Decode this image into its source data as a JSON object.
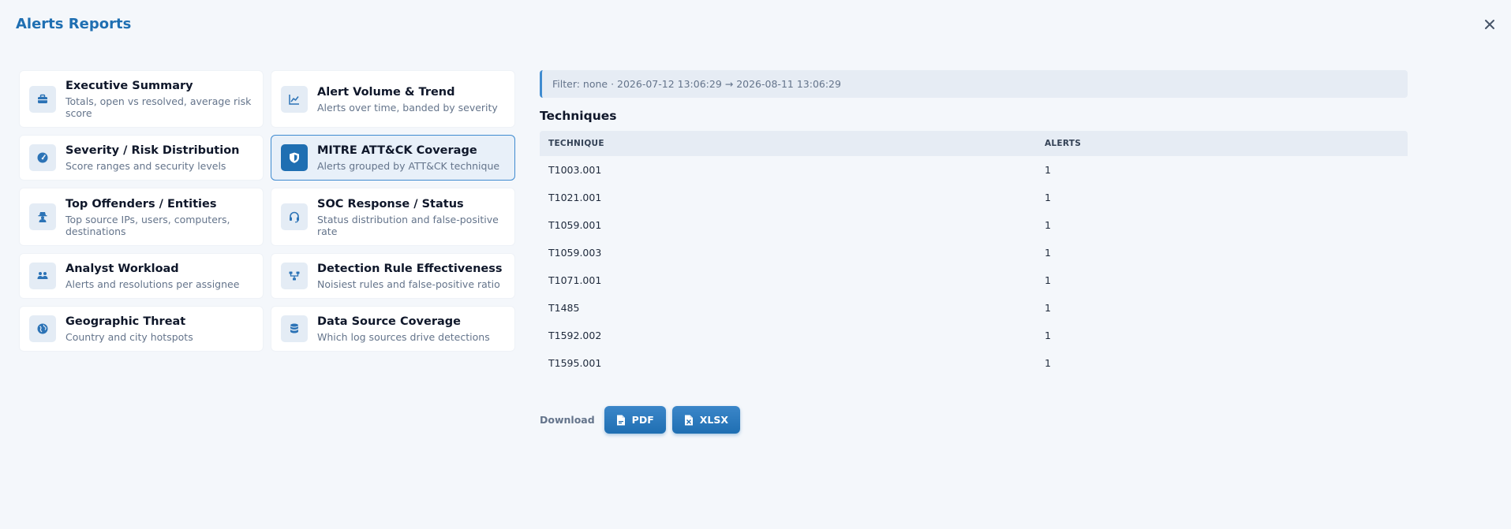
{
  "header": {
    "title": "Alerts Reports"
  },
  "filter": {
    "text": "Filter: none · 2026-07-12 13:06:29 → 2026-08-11 13:06:29"
  },
  "reports": [
    {
      "title": "Executive Summary",
      "desc": "Totals, open vs resolved, average risk score",
      "icon": "briefcase-icon"
    },
    {
      "title": "Alert Volume & Trend",
      "desc": "Alerts over time, banded by severity",
      "icon": "line-chart-icon"
    },
    {
      "title": "Severity / Risk Distribution",
      "desc": "Score ranges and security levels",
      "icon": "gauge-icon"
    },
    {
      "title": "MITRE ATT&CK Coverage",
      "desc": "Alerts grouped by ATT&CK technique",
      "icon": "shield-icon"
    },
    {
      "title": "Top Offenders / Entities",
      "desc": "Top source IPs, users, computers, destinations",
      "icon": "user-secret-icon"
    },
    {
      "title": "SOC Response / Status",
      "desc": "Status distribution and false-positive rate",
      "icon": "headset-icon"
    },
    {
      "title": "Analyst Workload",
      "desc": "Alerts and resolutions per assignee",
      "icon": "users-icon"
    },
    {
      "title": "Detection Rule Effectiveness",
      "desc": "Noisiest rules and false-positive ratio",
      "icon": "sitemap-icon"
    },
    {
      "title": "Geographic Threat",
      "desc": "Country and city hotspots",
      "icon": "globe-icon"
    },
    {
      "title": "Data Source Coverage",
      "desc": "Which log sources drive detections",
      "icon": "database-icon"
    }
  ],
  "active_report": "MITRE ATT&CK Coverage",
  "section": {
    "title": "Techniques"
  },
  "table": {
    "headers": [
      "TECHNIQUE",
      "ALERTS"
    ],
    "rows": [
      [
        "T1003.001",
        "1"
      ],
      [
        "T1021.001",
        "1"
      ],
      [
        "T1059.001",
        "1"
      ],
      [
        "T1059.003",
        "1"
      ],
      [
        "T1071.001",
        "1"
      ],
      [
        "T1485",
        "1"
      ],
      [
        "T1592.002",
        "1"
      ],
      [
        "T1595.001",
        "1"
      ]
    ]
  },
  "download": {
    "label": "Download",
    "pdf": "PDF",
    "xlsx": "XLSX"
  },
  "colors": {
    "accent": "#1f6fb2",
    "background": "#f4f7fb",
    "active_border": "#3f8bd0"
  }
}
